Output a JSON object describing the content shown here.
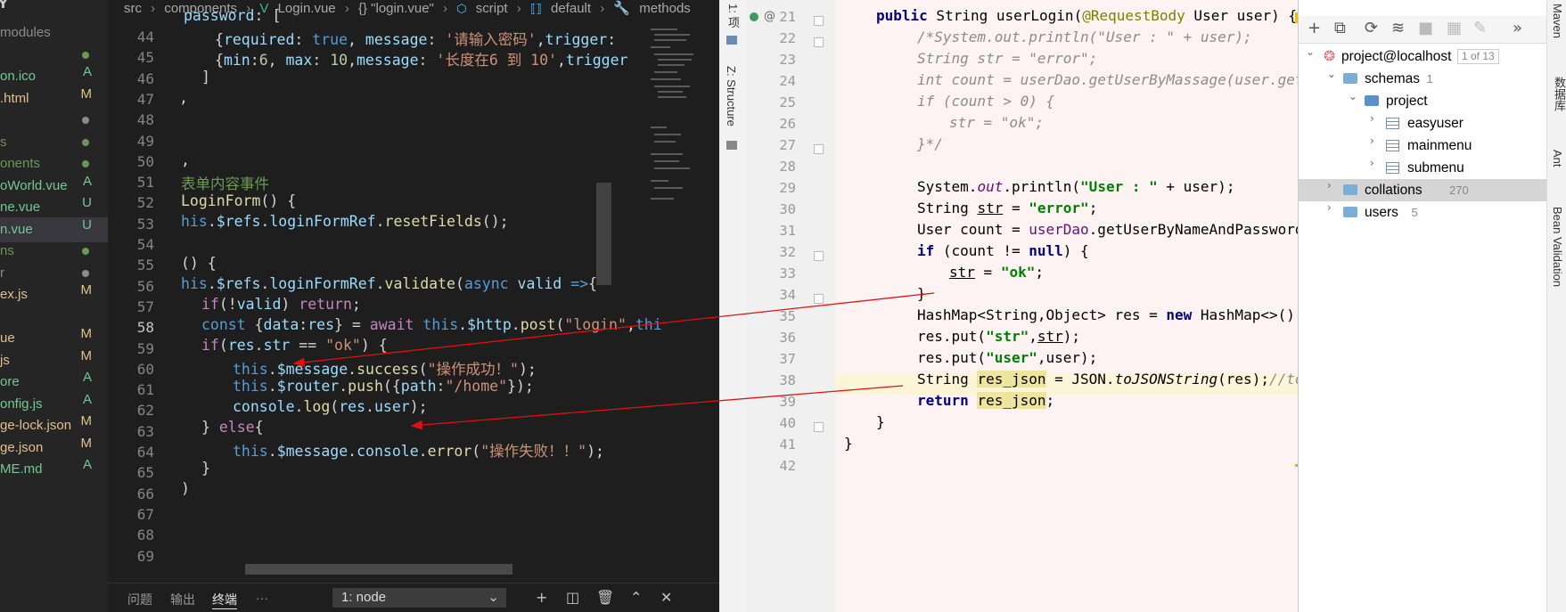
{
  "vscode": {
    "explorer": {
      "header": "Y",
      "items": [
        {
          "label": "modules",
          "status": "",
          "color": "#8c8c8c"
        },
        {
          "label": "",
          "status": "dot",
          "color": "#6a9955"
        },
        {
          "label": "on.ico",
          "status": "A",
          "color": "#73c991"
        },
        {
          "label": ".html",
          "status": "M",
          "color": "#e2c08d"
        },
        {
          "label": "",
          "status": "dot",
          "color": "#8c8c8c"
        },
        {
          "label": "s",
          "status": "dot",
          "color": "#6a9955"
        },
        {
          "label": "onents",
          "status": "dot",
          "color": "#6a9955"
        },
        {
          "label": "oWorld.vue",
          "status": "A",
          "color": "#73c991"
        },
        {
          "label": "ne.vue",
          "status": "U",
          "color": "#73c991"
        },
        {
          "label": "n.vue",
          "status": "U",
          "color": "#73c991"
        },
        {
          "label": "ns",
          "status": "dot",
          "color": "#6a9955"
        },
        {
          "label": "r",
          "status": "dot",
          "color": "#8c8c8c"
        },
        {
          "label": "ex.js",
          "status": "M",
          "color": "#e2c08d"
        },
        {
          "label": "",
          "status": "",
          "color": "#8c8c8c"
        },
        {
          "label": "ue",
          "status": "M",
          "color": "#e2c08d"
        },
        {
          "label": "js",
          "status": "M",
          "color": "#e2c08d"
        },
        {
          "label": "ore",
          "status": "A",
          "color": "#73c991"
        },
        {
          "label": "onfig.js",
          "status": "A",
          "color": "#73c991"
        },
        {
          "label": "ge-lock.json",
          "status": "M",
          "color": "#e2c08d"
        },
        {
          "label": "ge.json",
          "status": "M",
          "color": "#e2c08d"
        },
        {
          "label": "ME.md",
          "status": "A",
          "color": "#73c991"
        }
      ]
    },
    "breadcrumb": [
      "src",
      "components",
      "Login.vue",
      "{} \"login.vue\"",
      "script",
      "default",
      "methods"
    ],
    "line_numbers": [
      "44",
      "45",
      "46",
      "47",
      "48",
      "49",
      "50",
      "51",
      "52",
      "53",
      "54",
      "55",
      "56",
      "57",
      "58",
      "59",
      "60",
      "61",
      "62",
      "63",
      "64",
      "65",
      "66",
      "67",
      "68",
      "69"
    ],
    "current_line": "58",
    "panel": {
      "tabs": [
        "问题",
        "输出",
        "终端",
        "···"
      ],
      "active_tab": "终端",
      "terminal": "1: node"
    }
  },
  "idea": {
    "left_tool_windows": [
      "1: 项",
      "Z: Structure"
    ],
    "right_tool_windows": [
      "Maven",
      "数据库",
      "Ant",
      "Bean Validation"
    ],
    "line_numbers": [
      "21",
      "22",
      "23",
      "24",
      "25",
      "26",
      "27",
      "28",
      "29",
      "30",
      "31",
      "32",
      "33",
      "34",
      "35",
      "36",
      "37",
      "38",
      "39",
      "40",
      "41",
      "42"
    ],
    "database": {
      "root": "project@localhost",
      "root_badge": "1 of 13",
      "nodes": [
        {
          "label": "schemas",
          "count": "1",
          "kind": "folder"
        },
        {
          "label": "project",
          "count": "",
          "kind": "schema"
        },
        {
          "label": "easyuser",
          "count": "",
          "kind": "table"
        },
        {
          "label": "mainmenu",
          "count": "",
          "kind": "table"
        },
        {
          "label": "submenu",
          "count": "",
          "kind": "table"
        },
        {
          "label": "collations",
          "count": "270",
          "kind": "folder"
        },
        {
          "label": "users",
          "count": "5",
          "kind": "folder"
        }
      ]
    }
  }
}
